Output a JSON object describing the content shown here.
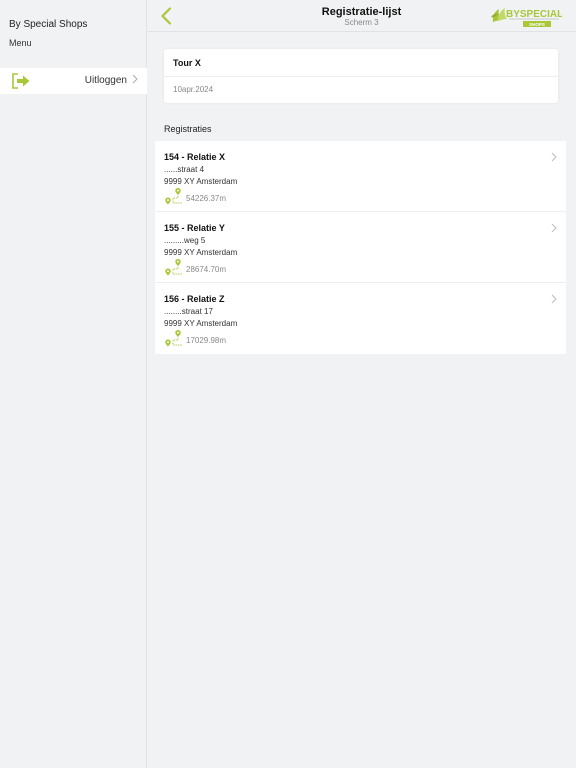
{
  "sidebar": {
    "title": "By Special Shops",
    "menu_label": "Menu",
    "logout_label": "Uitloggen"
  },
  "header": {
    "title": "Registratie-lijst",
    "subtitle": "Scherm 3",
    "logo_text": "BYSPECIAL",
    "logo_sub": "SHOPS"
  },
  "tour": {
    "name": "Tour X",
    "date": "10apr.2024"
  },
  "registrations_header": "Registraties",
  "registrations": [
    {
      "name": "154 - Relatie X",
      "street": "......straat 4",
      "city": "9999 XY Amsterdam",
      "distance": "54226.37m"
    },
    {
      "name": "155 - Relatie Y",
      "street": ".........weg 5",
      "city": "9999 XY Amsterdam",
      "distance": "28674.70m"
    },
    {
      "name": "156 - Relatie Z",
      "street": "........straat 17",
      "city": "9999 XY Amsterdam",
      "distance": "17029.98m"
    }
  ],
  "colors": {
    "accent": "#a8c83a",
    "background": "#f1f2f4",
    "card": "#ffffff"
  }
}
